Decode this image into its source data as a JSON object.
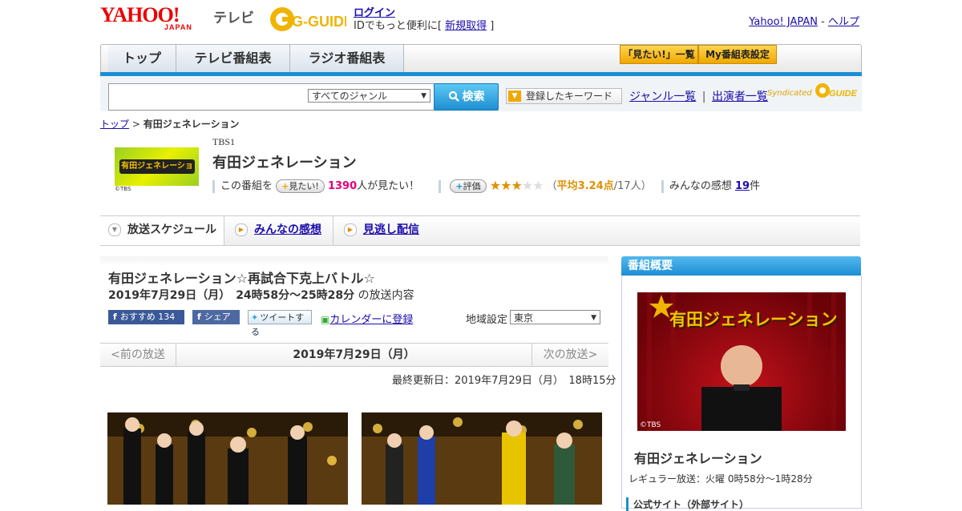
{
  "header": {
    "yahoo_logo": "YAHOO!",
    "japan_logo": "JAPAN",
    "tv_logo": "テレビ",
    "gguide_logo": "G-GUIDE",
    "login": "ログイン",
    "id_text": "IDでもっと便利に[",
    "register": "新規取得",
    "id_text_end": "]",
    "yahoo_japan": "Yahoo! JAPAN",
    "sep": "-",
    "help": "ヘルプ"
  },
  "nav": {
    "tabs": [
      "トップ",
      "テレビ番組表",
      "ラジオ番組表"
    ],
    "mitai_list": "「見たい!」一覧",
    "my_settings": "My番組表設定"
  },
  "search": {
    "placeholder": "",
    "genre": "すべてのジャンル",
    "button": "検索",
    "keyword_btn": "登録したキーワード",
    "genre_list": "ジャンル一覧",
    "pipe": "|",
    "cast_list": "出演者一覧",
    "syndicated": "Syndicated"
  },
  "breadcrumb": {
    "top": "トップ",
    "sep": ">",
    "current": "有田ジェネレーション"
  },
  "program": {
    "channel": "TBS1",
    "title": "有田ジェネレーション",
    "thumb_text": "有田ジェネレーション",
    "thumb_credit": "©TBS",
    "want_prefix": "この番組を",
    "want_btn": "見たい!",
    "want_count": "1390",
    "want_suffix": "人が見たい！",
    "rate_btn": "評価",
    "stars_filled": 3,
    "stars_total": 5,
    "avg_open": "（",
    "avg": "平均3.24点",
    "avg_count": "/17人）",
    "impression_label": "みんなの感想",
    "impression_count": "19",
    "impression_suffix": "件"
  },
  "tabs": [
    "放送スケジュール",
    "みんなの感想",
    "見逃し配信"
  ],
  "episode": {
    "title": "有田ジェネレーション☆再試合下克上バトル☆",
    "date": "2019年7月29日（月）　24時58分～25時28分",
    "date_suffix": "の放送内容",
    "fb_recommend": "おすすめ",
    "fb_count": "134",
    "fb_share": "シェア",
    "tweet": "ツイートする",
    "calendar": "カレンダーに登録",
    "region_label": "地域設定",
    "region": "東京"
  },
  "datenav": {
    "prev": "<前の放送",
    "current": "2019年7月29日（月）",
    "next": "次の放送>"
  },
  "updated": "最終更新日：2019年7月29日（月）　18時15分",
  "sidebar": {
    "header": "番組概要",
    "image_text": "有田ジェネレーション",
    "image_credit": "©TBS",
    "title": "有田ジェネレーション",
    "regular": "レギュラー放送：火曜 0時58分～1時28分",
    "official": "公式サイト（外部サイト）"
  },
  "colors": {
    "accent_blue": "#1b8ed4",
    "yahoo_red": "#e00000",
    "want_count": "#e4007f",
    "rating": "#e09000"
  }
}
